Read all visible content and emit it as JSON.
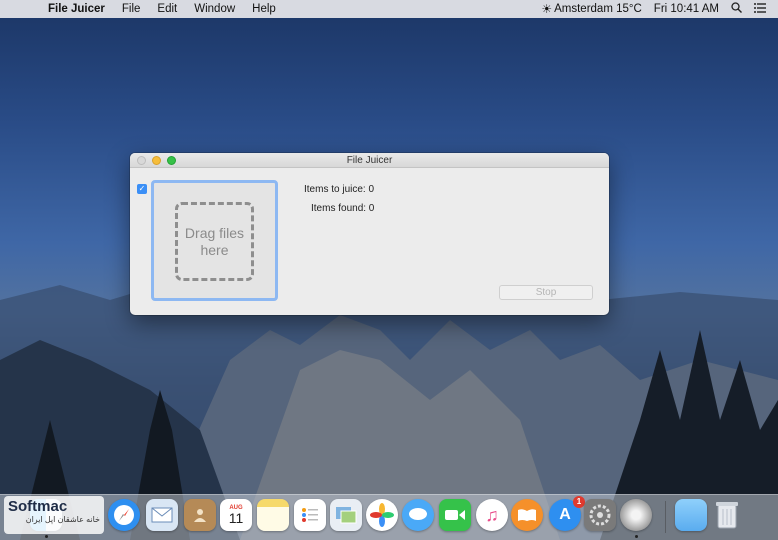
{
  "menubar": {
    "app_name": "File Juicer",
    "menus": [
      "File",
      "Edit",
      "Window",
      "Help"
    ],
    "weather": "Amsterdam 15°C",
    "clock": "Fri 10:41 AM"
  },
  "window": {
    "title": "File Juicer",
    "checkbox_checked": true,
    "dropzone_text": "Drag files here",
    "items_to_juice": "Items to juice: 0",
    "items_found": "Items found: 0",
    "stop_label": "Stop"
  },
  "dock": {
    "apps": [
      "finder",
      "safari",
      "mail",
      "contacts",
      "calendar",
      "notes",
      "reminders",
      "preview",
      "photos",
      "messages",
      "facetime",
      "itunes",
      "ibooks",
      "app-store",
      "system-preferences",
      "file-juicer",
      "downloads-folder",
      "trash"
    ],
    "calendar_month": "AUG",
    "calendar_day": "11",
    "app_store_badge": "1"
  },
  "watermark": {
    "brand": "Softmac",
    "subtitle": "خانه عاشقان اپل ایران"
  }
}
